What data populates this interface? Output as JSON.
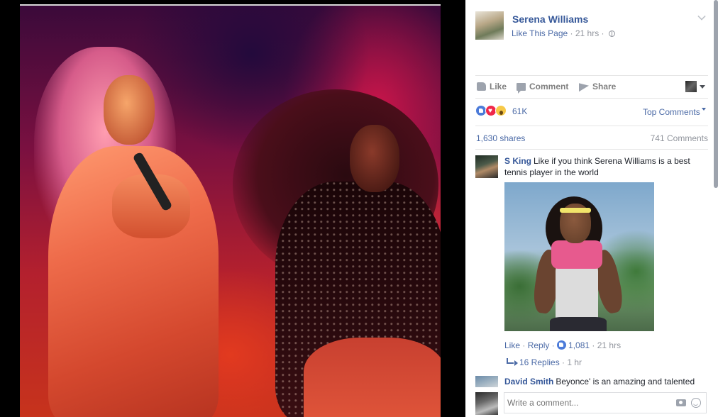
{
  "photo": {
    "alt_subject": "Two performers on stage"
  },
  "post": {
    "page_name": "Serena Williams",
    "like_page": "Like This Page",
    "separator": " · ",
    "time": "21 hrs",
    "time_suffix": " · "
  },
  "actions": {
    "like": "Like",
    "comment": "Comment",
    "share": "Share"
  },
  "reactions": {
    "count": "61K",
    "top_comments": "Top Comments"
  },
  "stats": {
    "shares": "1,630 shares",
    "comments": "741 Comments"
  },
  "comments": [
    {
      "author": "S King",
      "text": "Like if you think Serena Williams is a best tennis player in the world",
      "like": "Like",
      "reply": "Reply",
      "like_count": "1,081",
      "time": "21 hrs",
      "replies": "16 Replies",
      "replies_time": "1 hr"
    },
    {
      "author": "David Smith",
      "text": "Beyonce' is an amazing and talented"
    }
  ],
  "composer": {
    "placeholder": "Write a comment..."
  },
  "colors": {
    "link": "#365899",
    "meta": "#90949c"
  }
}
